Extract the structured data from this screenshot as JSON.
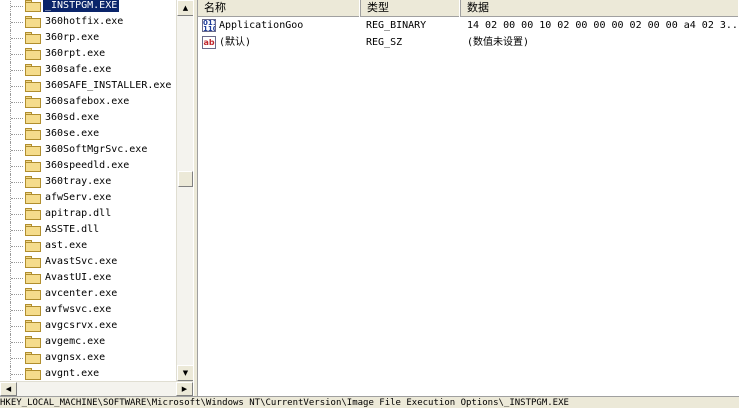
{
  "tree": {
    "items": [
      {
        "label": "_INSTPGM.EXE",
        "selected": true
      },
      {
        "label": "360hotfix.exe"
      },
      {
        "label": "360rp.exe"
      },
      {
        "label": "360rpt.exe"
      },
      {
        "label": "360safe.exe"
      },
      {
        "label": "360SAFE_INSTALLER.exe"
      },
      {
        "label": "360safebox.exe"
      },
      {
        "label": "360sd.exe"
      },
      {
        "label": "360se.exe"
      },
      {
        "label": "360SoftMgrSvc.exe"
      },
      {
        "label": "360speedld.exe"
      },
      {
        "label": "360tray.exe"
      },
      {
        "label": "afwServ.exe"
      },
      {
        "label": "apitrap.dll"
      },
      {
        "label": "ASSTE.dll"
      },
      {
        "label": "ast.exe"
      },
      {
        "label": "AvastSvc.exe"
      },
      {
        "label": "AvastUI.exe"
      },
      {
        "label": "avcenter.exe"
      },
      {
        "label": "avfwsvc.exe"
      },
      {
        "label": "avgcsrvx.exe"
      },
      {
        "label": "avgemc.exe"
      },
      {
        "label": "avgnsx.exe"
      },
      {
        "label": "avgnt.exe"
      }
    ]
  },
  "list": {
    "headers": {
      "name": "名称",
      "type": "类型",
      "data": "数据"
    },
    "rows": [
      {
        "icon": "binary-value-icon",
        "name": "ApplicationGoo",
        "type": "REG_BINARY",
        "data": "14 02 00 00 10 02 00 00 00 02 00 00 a4 02 3.."
      },
      {
        "icon": "string-value-icon",
        "name": "(默认)",
        "type": "REG_SZ",
        "data": "(数值未设置)"
      }
    ]
  },
  "status_bar": {
    "path": "HKEY_LOCAL_MACHINE\\SOFTWARE\\Microsoft\\Windows NT\\CurrentVersion\\Image File Execution Options\\_INSTPGM.EXE"
  },
  "colors": {
    "selection": "#0a246a",
    "chrome": "#ece9d8",
    "folder": "#f5dc8c"
  }
}
